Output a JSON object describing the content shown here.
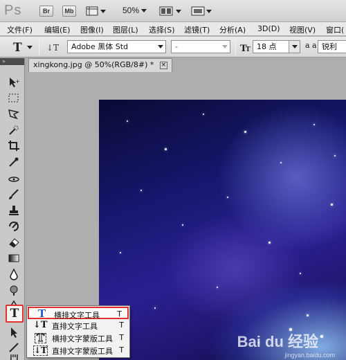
{
  "app": {
    "logo": "Ps",
    "bridge_btn": "Br",
    "minibridge_btn": "Mb",
    "zoom": "50%"
  },
  "menu": [
    {
      "label": "文件(F)"
    },
    {
      "label": "编辑(E)"
    },
    {
      "label": "图像(I)"
    },
    {
      "label": "图层(L)"
    },
    {
      "label": "选择(S)"
    },
    {
      "label": "滤镜(T)"
    },
    {
      "label": "分析(A)"
    },
    {
      "label": "3D(D)"
    },
    {
      "label": "视图(V)"
    },
    {
      "label": "窗口("
    }
  ],
  "options": {
    "font_family": "Adobe 黑体 Std",
    "font_style": "-",
    "font_size": "18 点",
    "aa_mode": "锐利",
    "aa_label": "a a"
  },
  "document": {
    "tab_title": "xingkong.jpg @ 50%(RGB/8#) *",
    "close_glyph": "×"
  },
  "canvas": {
    "watermark": "Bai du 经验",
    "watermark_sub": "jingyan.baidu.com"
  },
  "flyout": {
    "items": [
      {
        "icon": "T",
        "label": "横排文字工具",
        "key": "T"
      },
      {
        "icon": "↓T",
        "label": "直排文字工具",
        "key": "T"
      },
      {
        "icon": "T",
        "label": "横排文字蒙版工具",
        "key": "T"
      },
      {
        "icon": "↓T",
        "label": "直排文字蒙版工具",
        "key": "T"
      }
    ]
  },
  "toolpanel": {
    "collapse_glyph": "»",
    "type_tool_glyph": "T"
  },
  "colors": {
    "highlight": "#e03030",
    "panel": "#c9c9c9",
    "canvas_deep": "#171770"
  }
}
